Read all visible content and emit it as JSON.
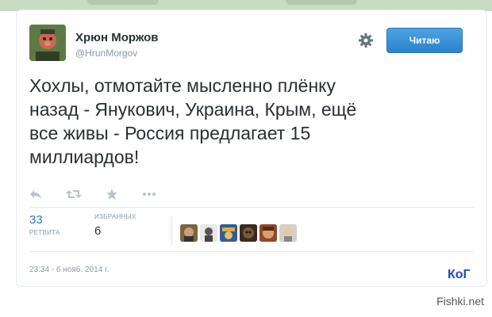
{
  "user": {
    "name": "Хрюн Моржов",
    "handle": "@HrunMorgov"
  },
  "follow_button": {
    "label": "Читаю"
  },
  "tweet": {
    "text": "Хохлы, отмотайте мысленно плёнку\nназад - Янукович, Украина, Крым, ещё\nвсе живы - Россия предлагает 15\nмиллиардов!"
  },
  "stats": {
    "retweets_count": "33",
    "retweets_label": "РЕТВИТА",
    "favorites_count": "6",
    "favorites_label": "ИЗБРАННЫХ"
  },
  "timestamp": "23:34 - 6 нояб. 2014 г.",
  "icons": {
    "reply": "reply-icon",
    "retweet": "retweet-icon",
    "favorite": "star-icon",
    "more": "more-icon",
    "settings": "gear-icon"
  },
  "colors": {
    "follow_button": "#2b82cb",
    "link": "#2b7bb9",
    "muted": "#8899a6",
    "text": "#292f33"
  },
  "watermarks": {
    "corner_signature": "КоГ",
    "site": "Fishki.net"
  }
}
